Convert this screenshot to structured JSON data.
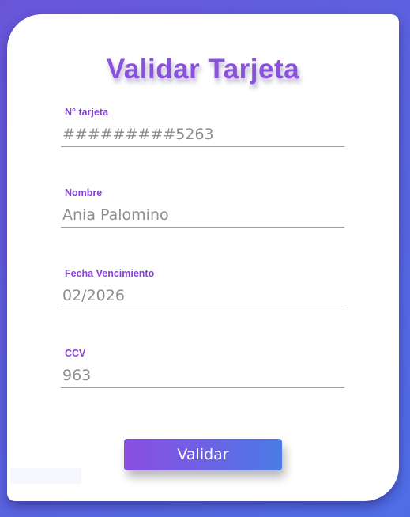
{
  "form": {
    "title": "Validar Tarjeta",
    "fields": [
      {
        "label": "N° tarjeta",
        "value": "#########5263"
      },
      {
        "label": "Nombre",
        "value": "Ania Palomino"
      },
      {
        "label": "Fecha Vencimiento",
        "value": "02/2026"
      },
      {
        "label": "CCV",
        "value": "963"
      }
    ],
    "submit_label": "Validar"
  },
  "colors": {
    "accent": "#8a50de",
    "label": "#8a3fe0",
    "background_start": "#6a55d9",
    "background_end": "#4f6ee6",
    "button_start": "#8a4fe2",
    "button_end": "#4a7be6"
  }
}
